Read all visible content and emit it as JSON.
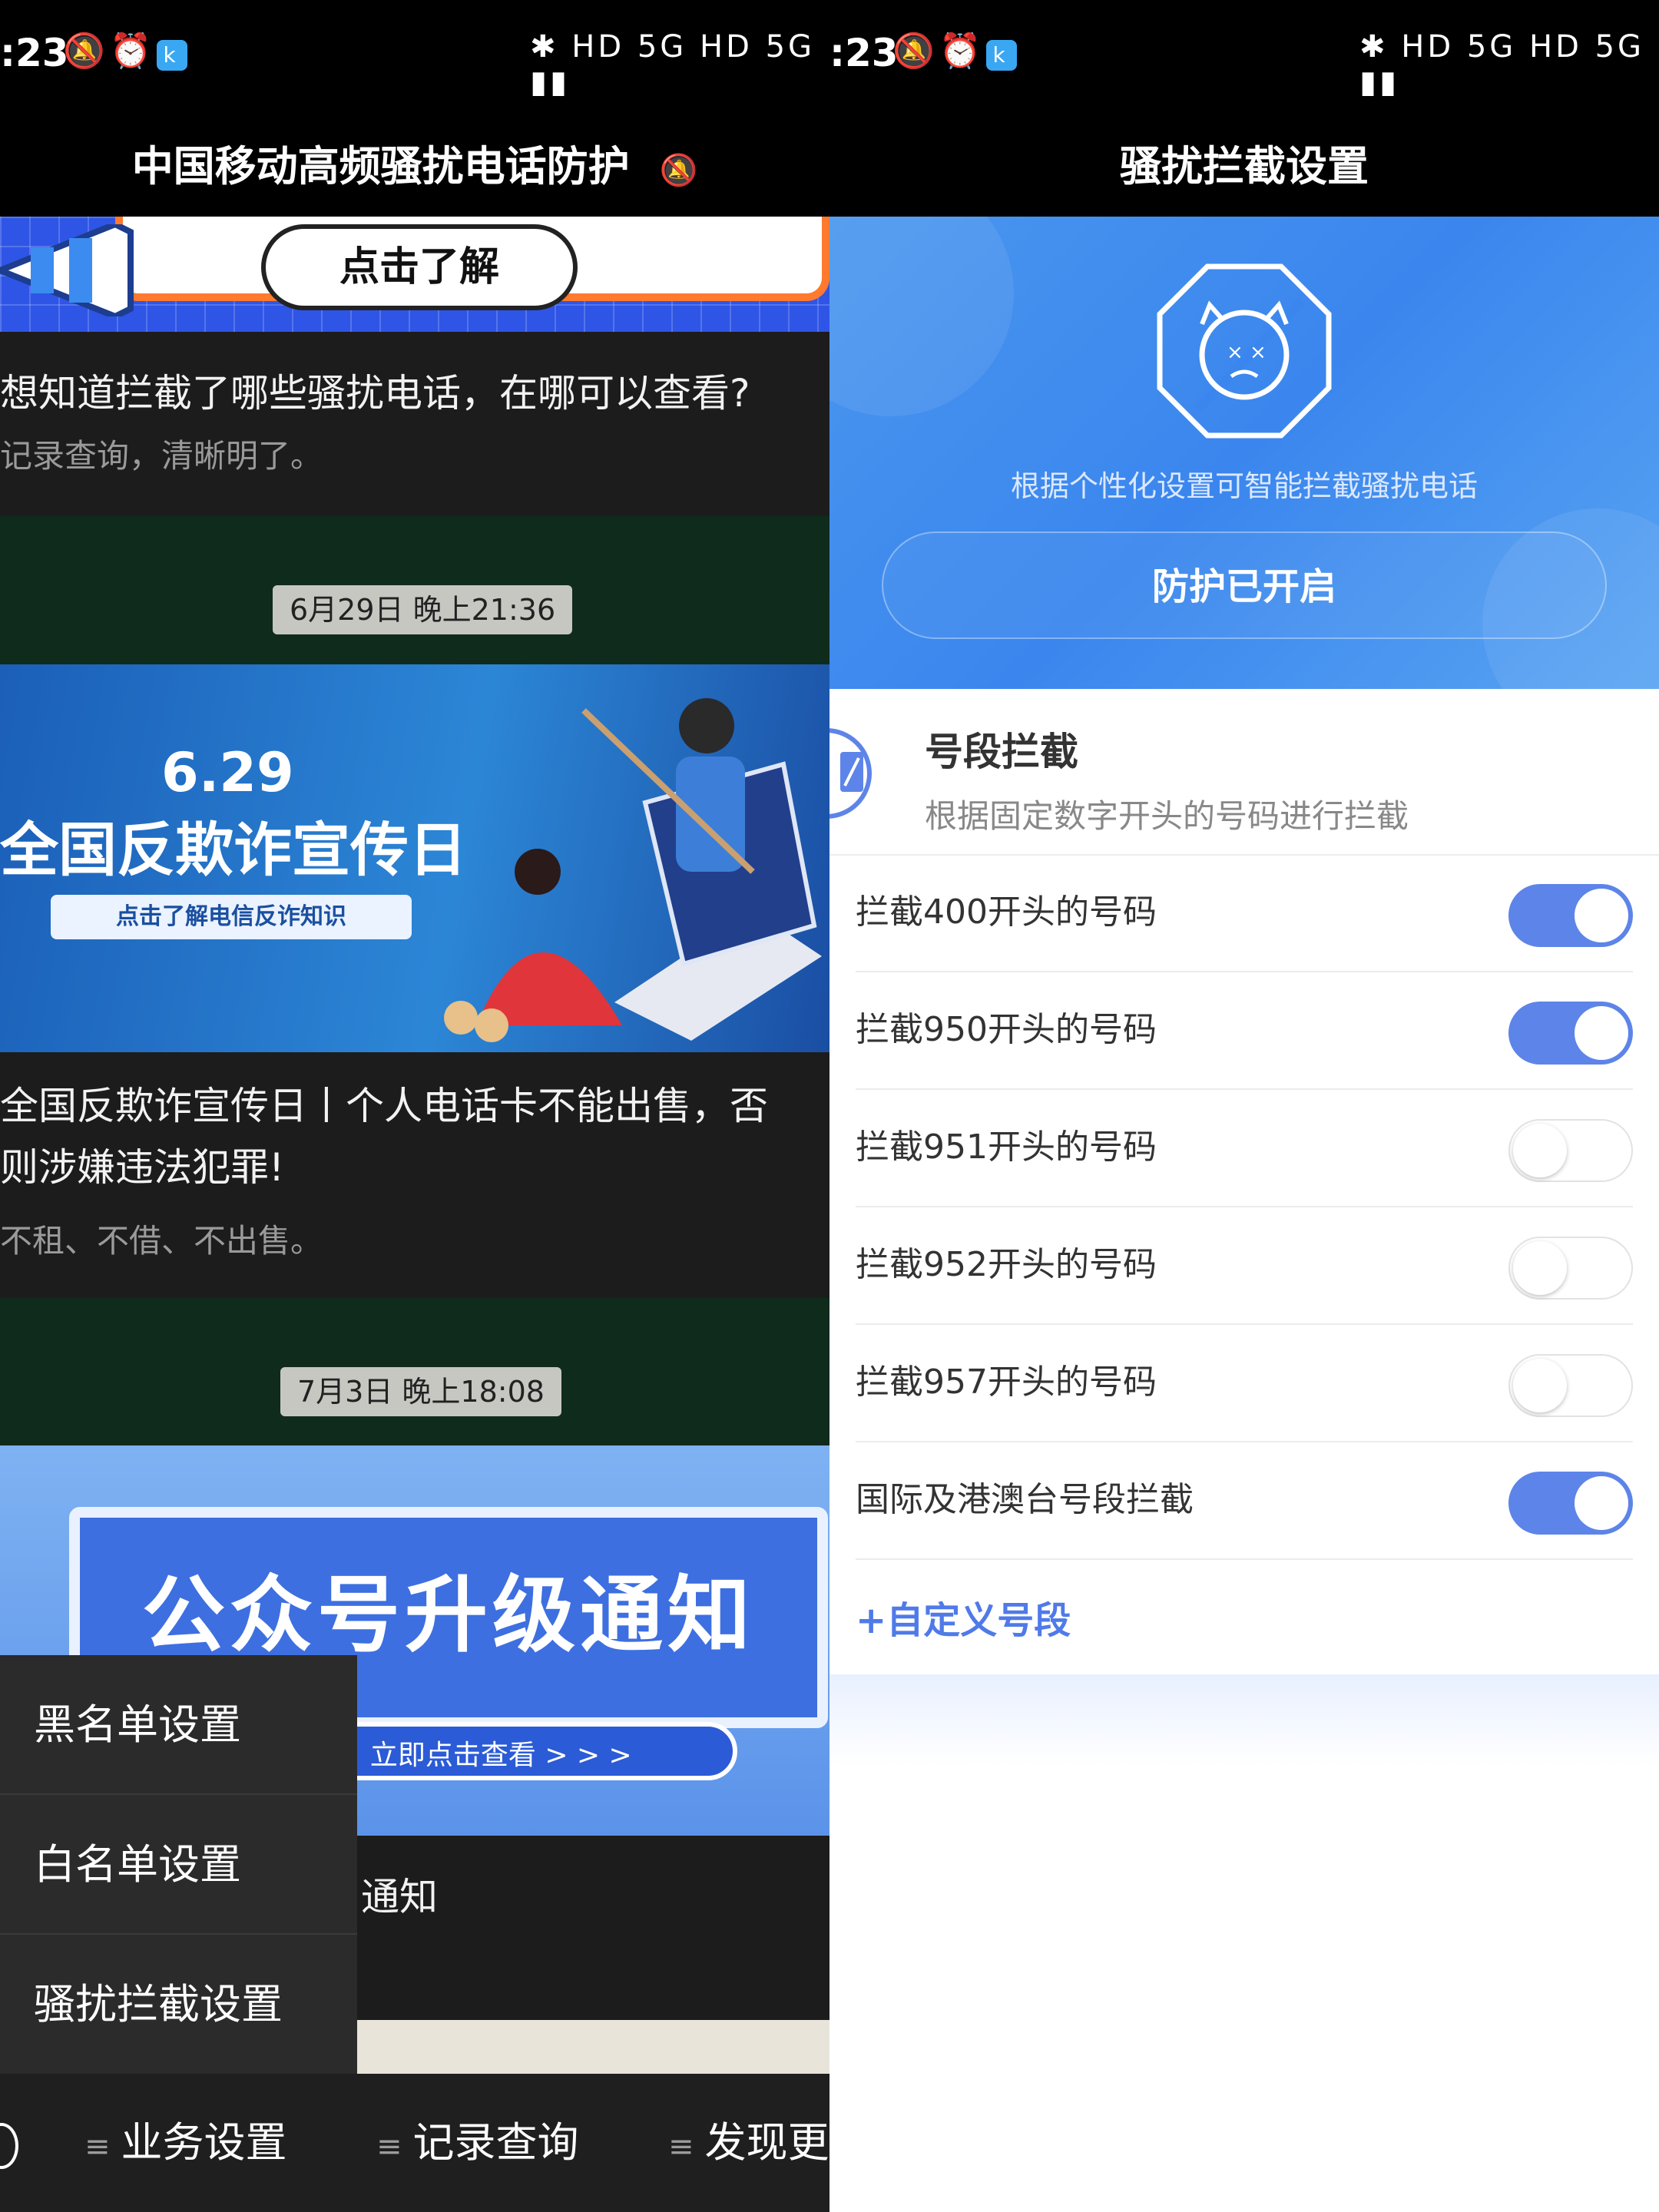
{
  "left": {
    "status": {
      "time": ":23",
      "right_icons": "HD 5G HD 5G"
    },
    "title": "中国移动高频骚扰电话防护",
    "banner_button": "点击了解",
    "article1": {
      "title": "想知道拦截了哪些骚扰电话，在哪可以查看?",
      "subtitle": "记录查询，清晰明了。"
    },
    "time1": "6月29日 晚上21:36",
    "banner629": {
      "date": "6.29",
      "headline": "全国反欺诈宣传日",
      "button": "点击了解电信反诈知识"
    },
    "article2": {
      "title_line1": "全国反欺诈宣传日丨个人电话卡不能出售，否",
      "title_line2": "则涉嫌违法犯罪!",
      "subtitle": "不租、不借、不出售。"
    },
    "time2": "7月3日 晚上18:08",
    "banner_upgrade": {
      "headline": "公众号升级通知",
      "pill": "!  立即点击查看 > > >"
    },
    "behind_text": "通知",
    "menu": [
      "黑名单设置",
      "白名单设置",
      "骚扰拦截设置"
    ],
    "nav": [
      "业务设置",
      "记录查询",
      "发现更"
    ]
  },
  "right": {
    "status": {
      "time": ":23",
      "right_icons": "HD 5G HD 5G"
    },
    "title": "骚扰拦截设置",
    "hero_caption": "根据个性化设置可智能拦截骚扰电话",
    "hero_button": "防护已开启",
    "section": {
      "title": "号段拦截",
      "subtitle": "根据固定数字开头的号码进行拦截"
    },
    "rows": [
      {
        "label": "拦截400开头的号码",
        "enabled": true
      },
      {
        "label": "拦截950开头的号码",
        "enabled": true
      },
      {
        "label": "拦截951开头的号码",
        "enabled": false
      },
      {
        "label": "拦截952开头的号码",
        "enabled": false
      },
      {
        "label": "拦截957开头的号码",
        "enabled": false
      },
      {
        "label": "国际及港澳台号段拦截",
        "enabled": true
      }
    ],
    "add_custom": "+自定义号段"
  },
  "colors": {
    "accent": "#5d84e8",
    "hero_blue": "#3a86ee",
    "dark_bg": "#1c1c1c",
    "time_band": "#0f2b1c"
  }
}
